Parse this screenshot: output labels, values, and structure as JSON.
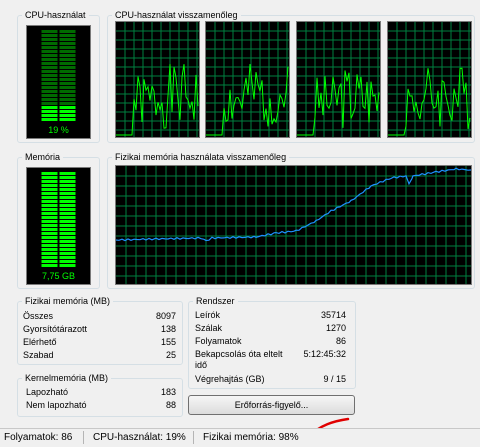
{
  "cpu_usage": {
    "title": "CPU-használat",
    "value": "19 %",
    "level": 0.19
  },
  "cpu_history": {
    "title": "CPU-használat visszamenőleg"
  },
  "memory": {
    "title": "Memória",
    "value": "7,75 GB",
    "level": 0.98
  },
  "memory_history": {
    "title": "Fizikai memória használata visszamenőleg"
  },
  "physical_memory": {
    "title": "Fizikai memória (MB)",
    "rows": [
      {
        "label": "Összes",
        "value": "8097"
      },
      {
        "label": "Gyorsítótárazott",
        "value": "138"
      },
      {
        "label": "Elérhető",
        "value": "155"
      },
      {
        "label": "Szabad",
        "value": "25"
      }
    ]
  },
  "kernel_memory": {
    "title": "Kernelmemória (MB)",
    "rows": [
      {
        "label": "Lapozható",
        "value": "183"
      },
      {
        "label": "Nem lapozható",
        "value": "88"
      }
    ]
  },
  "system": {
    "title": "Rendszer",
    "rows": [
      {
        "label": "Leírók",
        "value": "35714"
      },
      {
        "label": "Szálak",
        "value": "1270"
      },
      {
        "label": "Folyamatok",
        "value": "86"
      },
      {
        "label": "Bekapcsolás óta eltelt",
        "label2": "idő",
        "value": "5:12:45:32"
      },
      {
        "label": "Végrehajtás (GB)",
        "value": "9 / 15"
      }
    ]
  },
  "resource_monitor_button": "Erőforrás-figyelő...",
  "status_bar": {
    "processes": "Folyamatok: 86",
    "cpu": "CPU-használat: 19%",
    "memory": "Fizikai memória: 98%"
  },
  "colors": {
    "graph_grid": "#008040",
    "cpu_line": "#00ff00",
    "memory_line": "#1e90ff",
    "annotation_arrow": "#e00000"
  }
}
